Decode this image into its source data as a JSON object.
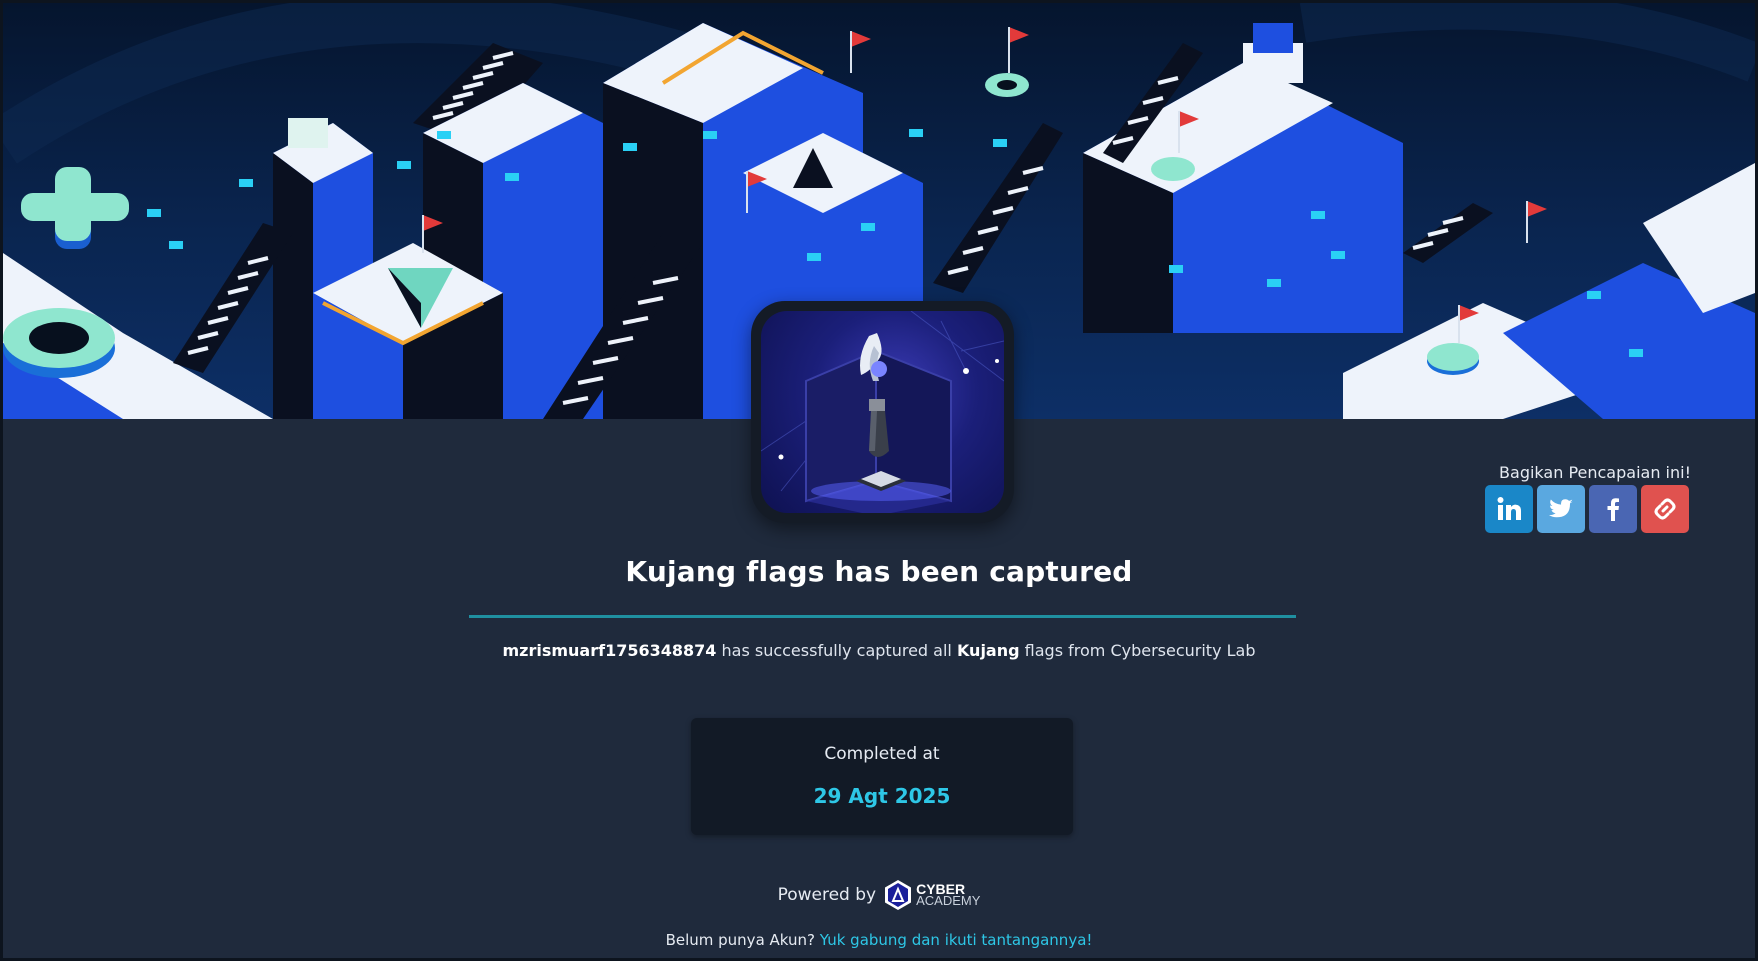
{
  "share": {
    "label": "Bagikan Pencapaian ini!",
    "buttons": [
      {
        "name": "linkedin",
        "icon": "linkedin-icon",
        "color": "#1a87c8"
      },
      {
        "name": "twitter",
        "icon": "twitter-icon",
        "color": "#5aa8e0"
      },
      {
        "name": "facebook",
        "icon": "facebook-icon",
        "color": "#4a66b3"
      },
      {
        "name": "copy-link",
        "icon": "link-icon",
        "color": "#e0524f"
      }
    ]
  },
  "achievement": {
    "title": "Kujang flags has been captured",
    "username": "mzrismuarf1756348874",
    "desc_middle": " has successfully captured all ",
    "flag_name": "Kujang",
    "desc_end": " flags from Cybersecurity Lab"
  },
  "completed": {
    "label": "Completed at",
    "date": "29 Agt 2025"
  },
  "powered": {
    "label": "Powered by",
    "logo_line1": "CYBER",
    "logo_line2": "ACADEMY"
  },
  "footer": {
    "prompt": "Belum punya Akun?",
    "link_text": "Yuk gabung dan ikuti tantangannya!"
  },
  "colors": {
    "accent": "#2ec7e6",
    "background": "#1f2a3c",
    "divider": "#1f8fa0"
  }
}
